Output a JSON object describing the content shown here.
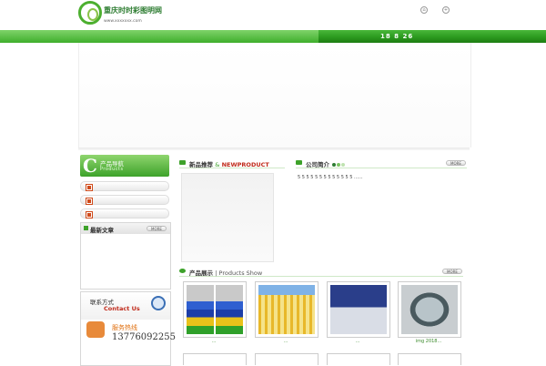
{
  "header": {
    "site_name": "重庆时时彩图明网",
    "url": "www.xxxxxxx.com",
    "date": "18 8 26"
  },
  "sidebar": {
    "product_nav_title": "产品导航",
    "product_nav_sub": "Products",
    "latest_title": "最新文章",
    "more_label": "MORE",
    "contact_title": "联系方式",
    "contact_sub": "Contact Us",
    "hotline_label": "服务热线",
    "hotline_number": "13776092255"
  },
  "sections": {
    "new_product_title": "新品推荐",
    "new_product_amp": "&",
    "new_product_en": "NEWPRODUCT",
    "company_title": "公司简介",
    "company_text": "5 5 5 5 5 5 5 5 5 5 5 5 5 ......",
    "products_title": "产品展示",
    "products_sub": "| Products Show",
    "more_label": "MORE"
  },
  "products": [
    {
      "caption": "..."
    },
    {
      "caption": "..."
    },
    {
      "caption": "..."
    },
    {
      "caption": "img 2018..."
    }
  ],
  "colors": {
    "brand_green": "#3da22a",
    "accent_red": "#c02a1a"
  }
}
